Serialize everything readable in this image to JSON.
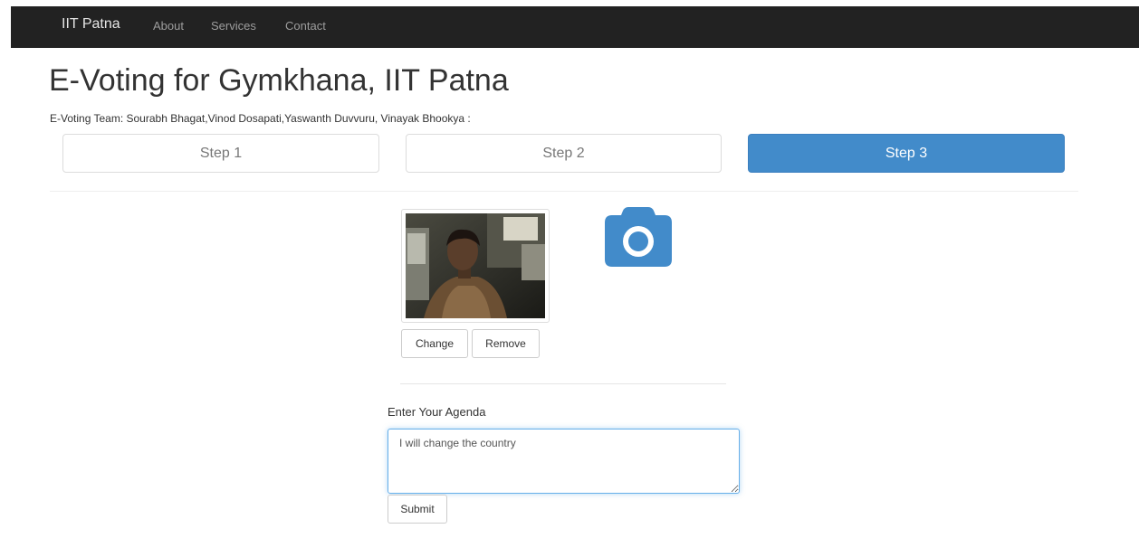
{
  "navbar": {
    "brand": "IIT Patna",
    "links": [
      "About",
      "Services",
      "Contact"
    ]
  },
  "page": {
    "title": "E-Voting for Gymkhana, IIT Patna",
    "team": "E-Voting Team: Sourabh Bhagat,Vinod Dosapati,Yaswanth Duvvuru, Vinayak Bhookya :"
  },
  "steps": {
    "items": [
      "Step 1",
      "Step 2",
      "Step 3"
    ],
    "active_index": 2,
    "active_color": "#428bca"
  },
  "photo_upload": {
    "change_label": "Change",
    "remove_label": "Remove",
    "camera_icon": "camera-icon",
    "camera_color": "#428bca"
  },
  "agenda": {
    "label": "Enter Your Agenda",
    "value": "I will change the country",
    "submit_label": "Submit"
  }
}
